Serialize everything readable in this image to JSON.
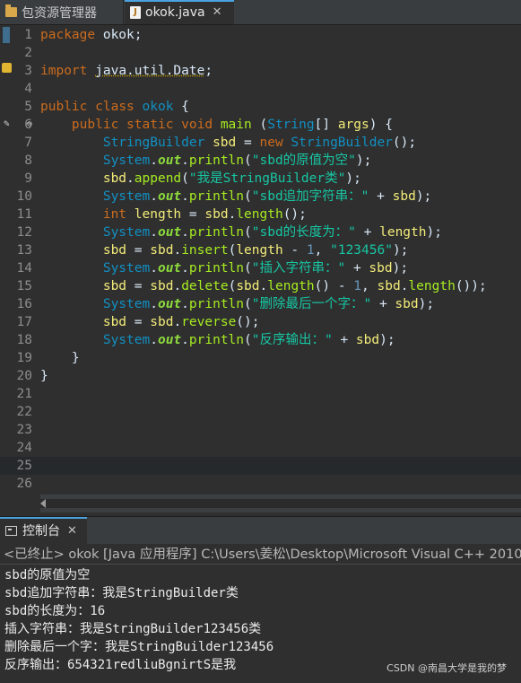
{
  "tabs": {
    "package_explorer": "包资源管理器",
    "editor_file": "okok.java",
    "close_glyph": "✕"
  },
  "editor": {
    "current_line": 25,
    "lines": [
      {
        "n": "1",
        "tokens": [
          [
            "kw",
            "package"
          ],
          [
            "id",
            " okok;"
          ]
        ]
      },
      {
        "n": "2",
        "tokens": []
      },
      {
        "n": "3",
        "tokens": [
          [
            "kw",
            "import"
          ],
          [
            "id",
            " "
          ],
          [
            "pkgname",
            "java.util.Date"
          ],
          [
            "id",
            ";"
          ]
        ]
      },
      {
        "n": "4",
        "tokens": []
      },
      {
        "n": "5",
        "tokens": [
          [
            "kw",
            "public"
          ],
          [
            "id",
            " "
          ],
          [
            "kw",
            "class"
          ],
          [
            "id",
            " "
          ],
          [
            "cls",
            "okok"
          ],
          [
            "id",
            " {"
          ]
        ]
      },
      {
        "n": "6",
        "fold": "⊖",
        "tokens": [
          [
            "id",
            "    "
          ],
          [
            "kw",
            "public"
          ],
          [
            "id",
            " "
          ],
          [
            "kw",
            "static"
          ],
          [
            "id",
            " "
          ],
          [
            "kw",
            "void"
          ],
          [
            "id",
            " "
          ],
          [
            "mth",
            "main"
          ],
          [
            "id",
            " ("
          ],
          [
            "cls",
            "String"
          ],
          [
            "id",
            "[] "
          ],
          [
            "var",
            "args"
          ],
          [
            "id",
            ") {"
          ]
        ]
      },
      {
        "n": "7",
        "tokens": [
          [
            "id",
            "        "
          ],
          [
            "cls",
            "StringBuilder"
          ],
          [
            "id",
            " "
          ],
          [
            "var",
            "sbd"
          ],
          [
            "id",
            " = "
          ],
          [
            "kw",
            "new"
          ],
          [
            "id",
            " "
          ],
          [
            "cls",
            "StringBuilder"
          ],
          [
            "id",
            "();"
          ]
        ]
      },
      {
        "n": "8",
        "tokens": [
          [
            "id",
            "        "
          ],
          [
            "cls",
            "System"
          ],
          [
            "id",
            "."
          ],
          [
            "fld",
            "out"
          ],
          [
            "id",
            "."
          ],
          [
            "mth",
            "println"
          ],
          [
            "id",
            "("
          ],
          [
            "str",
            "\"sbd的原值为空\""
          ],
          [
            "id",
            ");"
          ]
        ]
      },
      {
        "n": "9",
        "tokens": [
          [
            "id",
            "        "
          ],
          [
            "var",
            "sbd"
          ],
          [
            "id",
            "."
          ],
          [
            "mth",
            "append"
          ],
          [
            "id",
            "("
          ],
          [
            "str",
            "\"我是StringBuilder类\""
          ],
          [
            "id",
            ");"
          ]
        ]
      },
      {
        "n": "10",
        "tokens": [
          [
            "id",
            "        "
          ],
          [
            "cls",
            "System"
          ],
          [
            "id",
            "."
          ],
          [
            "fld",
            "out"
          ],
          [
            "id",
            "."
          ],
          [
            "mth",
            "println"
          ],
          [
            "id",
            "("
          ],
          [
            "str",
            "\"sbd追加字符串：\""
          ],
          [
            "id",
            " + "
          ],
          [
            "var",
            "sbd"
          ],
          [
            "id",
            ");"
          ]
        ]
      },
      {
        "n": "11",
        "tokens": [
          [
            "id",
            "        "
          ],
          [
            "kw",
            "int"
          ],
          [
            "id",
            " "
          ],
          [
            "var",
            "length"
          ],
          [
            "id",
            " = "
          ],
          [
            "var",
            "sbd"
          ],
          [
            "id",
            "."
          ],
          [
            "mth",
            "length"
          ],
          [
            "id",
            "();"
          ]
        ]
      },
      {
        "n": "12",
        "tokens": [
          [
            "id",
            "        "
          ],
          [
            "cls",
            "System"
          ],
          [
            "id",
            "."
          ],
          [
            "fld",
            "out"
          ],
          [
            "id",
            "."
          ],
          [
            "mth",
            "println"
          ],
          [
            "id",
            "("
          ],
          [
            "str",
            "\"sbd的长度为：\""
          ],
          [
            "id",
            " + "
          ],
          [
            "var",
            "length"
          ],
          [
            "id",
            ");"
          ]
        ]
      },
      {
        "n": "13",
        "tokens": [
          [
            "id",
            "        "
          ],
          [
            "var",
            "sbd"
          ],
          [
            "id",
            " = "
          ],
          [
            "var",
            "sbd"
          ],
          [
            "id",
            "."
          ],
          [
            "mth",
            "insert"
          ],
          [
            "id",
            "("
          ],
          [
            "var",
            "length"
          ],
          [
            "id",
            " - "
          ],
          [
            "num",
            "1"
          ],
          [
            "id",
            ", "
          ],
          [
            "str",
            "\"123456\""
          ],
          [
            "id",
            ");"
          ]
        ]
      },
      {
        "n": "14",
        "tokens": [
          [
            "id",
            "        "
          ],
          [
            "cls",
            "System"
          ],
          [
            "id",
            "."
          ],
          [
            "fld",
            "out"
          ],
          [
            "id",
            "."
          ],
          [
            "mth",
            "println"
          ],
          [
            "id",
            "("
          ],
          [
            "str",
            "\"插入字符串：\""
          ],
          [
            "id",
            " + "
          ],
          [
            "var",
            "sbd"
          ],
          [
            "id",
            ");"
          ]
        ]
      },
      {
        "n": "15",
        "tokens": [
          [
            "id",
            "        "
          ],
          [
            "var",
            "sbd"
          ],
          [
            "id",
            " = "
          ],
          [
            "var",
            "sbd"
          ],
          [
            "id",
            "."
          ],
          [
            "mth",
            "delete"
          ],
          [
            "id",
            "("
          ],
          [
            "var",
            "sbd"
          ],
          [
            "id",
            "."
          ],
          [
            "mth",
            "length"
          ],
          [
            "id",
            "() - "
          ],
          [
            "num",
            "1"
          ],
          [
            "id",
            ", "
          ],
          [
            "var",
            "sbd"
          ],
          [
            "id",
            "."
          ],
          [
            "mth",
            "length"
          ],
          [
            "id",
            "());"
          ]
        ]
      },
      {
        "n": "16",
        "tokens": [
          [
            "id",
            "        "
          ],
          [
            "cls",
            "System"
          ],
          [
            "id",
            "."
          ],
          [
            "fld",
            "out"
          ],
          [
            "id",
            "."
          ],
          [
            "mth",
            "println"
          ],
          [
            "id",
            "("
          ],
          [
            "str",
            "\"删除最后一个字：\""
          ],
          [
            "id",
            " + "
          ],
          [
            "var",
            "sbd"
          ],
          [
            "id",
            ");"
          ]
        ]
      },
      {
        "n": "17",
        "tokens": [
          [
            "id",
            "        "
          ],
          [
            "var",
            "sbd"
          ],
          [
            "id",
            " = "
          ],
          [
            "var",
            "sbd"
          ],
          [
            "id",
            "."
          ],
          [
            "mth",
            "reverse"
          ],
          [
            "id",
            "();"
          ]
        ]
      },
      {
        "n": "18",
        "tokens": [
          [
            "id",
            "        "
          ],
          [
            "cls",
            "System"
          ],
          [
            "id",
            "."
          ],
          [
            "fld",
            "out"
          ],
          [
            "id",
            "."
          ],
          [
            "mth",
            "println"
          ],
          [
            "id",
            "("
          ],
          [
            "str",
            "\"反序输出：\""
          ],
          [
            "id",
            " + "
          ],
          [
            "var",
            "sbd"
          ],
          [
            "id",
            ");"
          ]
        ]
      },
      {
        "n": "19",
        "tokens": [
          [
            "id",
            "    }"
          ]
        ]
      },
      {
        "n": "20",
        "tokens": [
          [
            "id",
            "}"
          ]
        ]
      },
      {
        "n": "21",
        "tokens": []
      },
      {
        "n": "22",
        "tokens": []
      },
      {
        "n": "23",
        "tokens": []
      },
      {
        "n": "24",
        "tokens": []
      },
      {
        "n": "25",
        "tokens": []
      },
      {
        "n": "26",
        "tokens": []
      }
    ]
  },
  "console": {
    "tab_label": "控制台",
    "close_glyph": "✕",
    "terminated_info": "<已终止> okok [Java 应用程序] C:\\Users\\姜松\\Desktop\\Microsoft Visual C++ 2010",
    "output": [
      "sbd的原值为空",
      "sbd追加字符串：我是StringBuilder类",
      "sbd的长度为：16",
      "插入字符串：我是StringBuilder123456类",
      "删除最后一个字：我是StringBuilder123456",
      "反序输出：654321redliuBgnirtS是我"
    ]
  },
  "watermark": "CSDN @南昌大学是我的梦",
  "colors": {
    "background": "#2f2f2f",
    "keyword": "#cc6c1d",
    "class": "#1290c3",
    "method": "#a7ec21",
    "string": "#17c6a3",
    "variable": "#f3ec79"
  }
}
